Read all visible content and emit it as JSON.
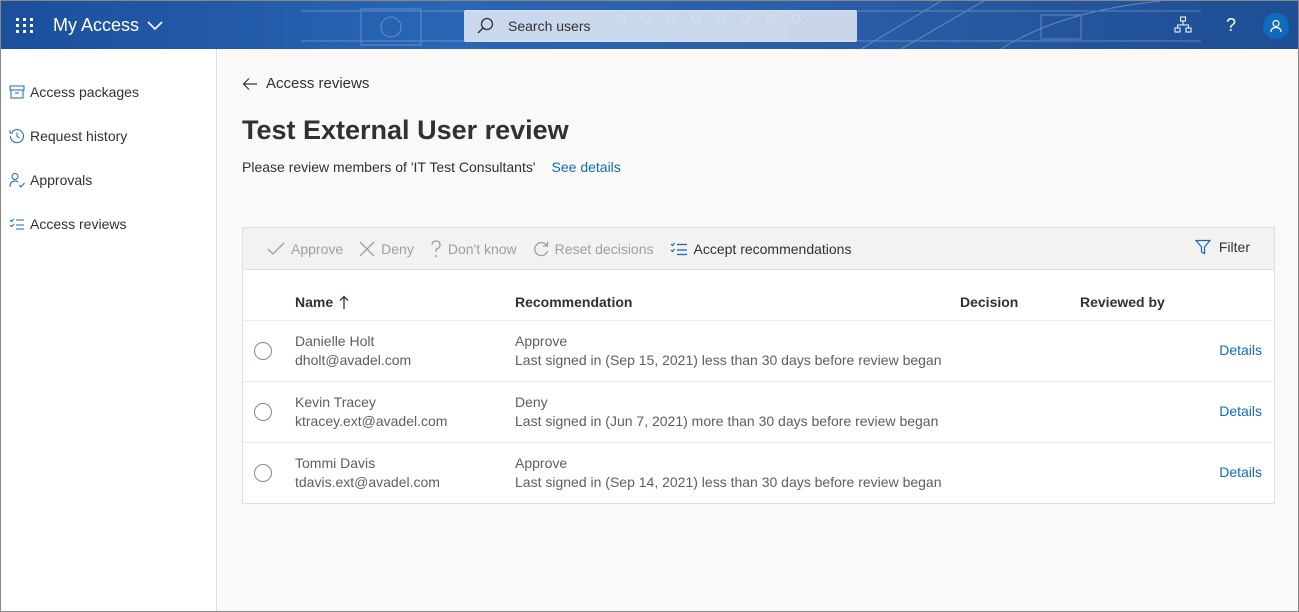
{
  "header": {
    "app_title": "My Access",
    "search_placeholder": "Search users",
    "help_label": "?"
  },
  "sidebar": {
    "items": [
      {
        "label": "Access packages",
        "icon": "package-icon"
      },
      {
        "label": "Request history",
        "icon": "history-icon"
      },
      {
        "label": "Approvals",
        "icon": "person-check-icon"
      },
      {
        "label": "Access reviews",
        "icon": "checklist-icon"
      }
    ]
  },
  "main": {
    "back_label": "Access reviews",
    "title": "Test External User review",
    "subtitle": "Please review members of 'IT Test Consultants'",
    "see_details": "See details"
  },
  "toolbar": {
    "approve": "Approve",
    "deny": "Deny",
    "dont_know": "Don't know",
    "reset": "Reset decisions",
    "accept": "Accept recommendations",
    "filter": "Filter"
  },
  "table": {
    "columns": {
      "name": "Name",
      "recommendation": "Recommendation",
      "decision": "Decision",
      "reviewed_by": "Reviewed by"
    },
    "details_label": "Details",
    "rows": [
      {
        "name": "Danielle Holt",
        "email": "dholt@avadel.com",
        "recommendation": "Approve",
        "reason": "Last signed in (Sep 15, 2021) less than 30 days before review began"
      },
      {
        "name": "Kevin Tracey",
        "email": "ktracey.ext@avadel.com",
        "recommendation": "Deny",
        "reason": "Last signed in (Jun 7, 2021) more than 30 days before review began"
      },
      {
        "name": "Tommi Davis",
        "email": "tdavis.ext@avadel.com",
        "recommendation": "Approve",
        "reason": "Last signed in (Sep 14, 2021) less than 30 days before review began"
      }
    ]
  },
  "colors": {
    "header_blue": "#2a66b5",
    "link_blue": "#0f6cbd",
    "disabled_gray": "#a19f9d"
  }
}
